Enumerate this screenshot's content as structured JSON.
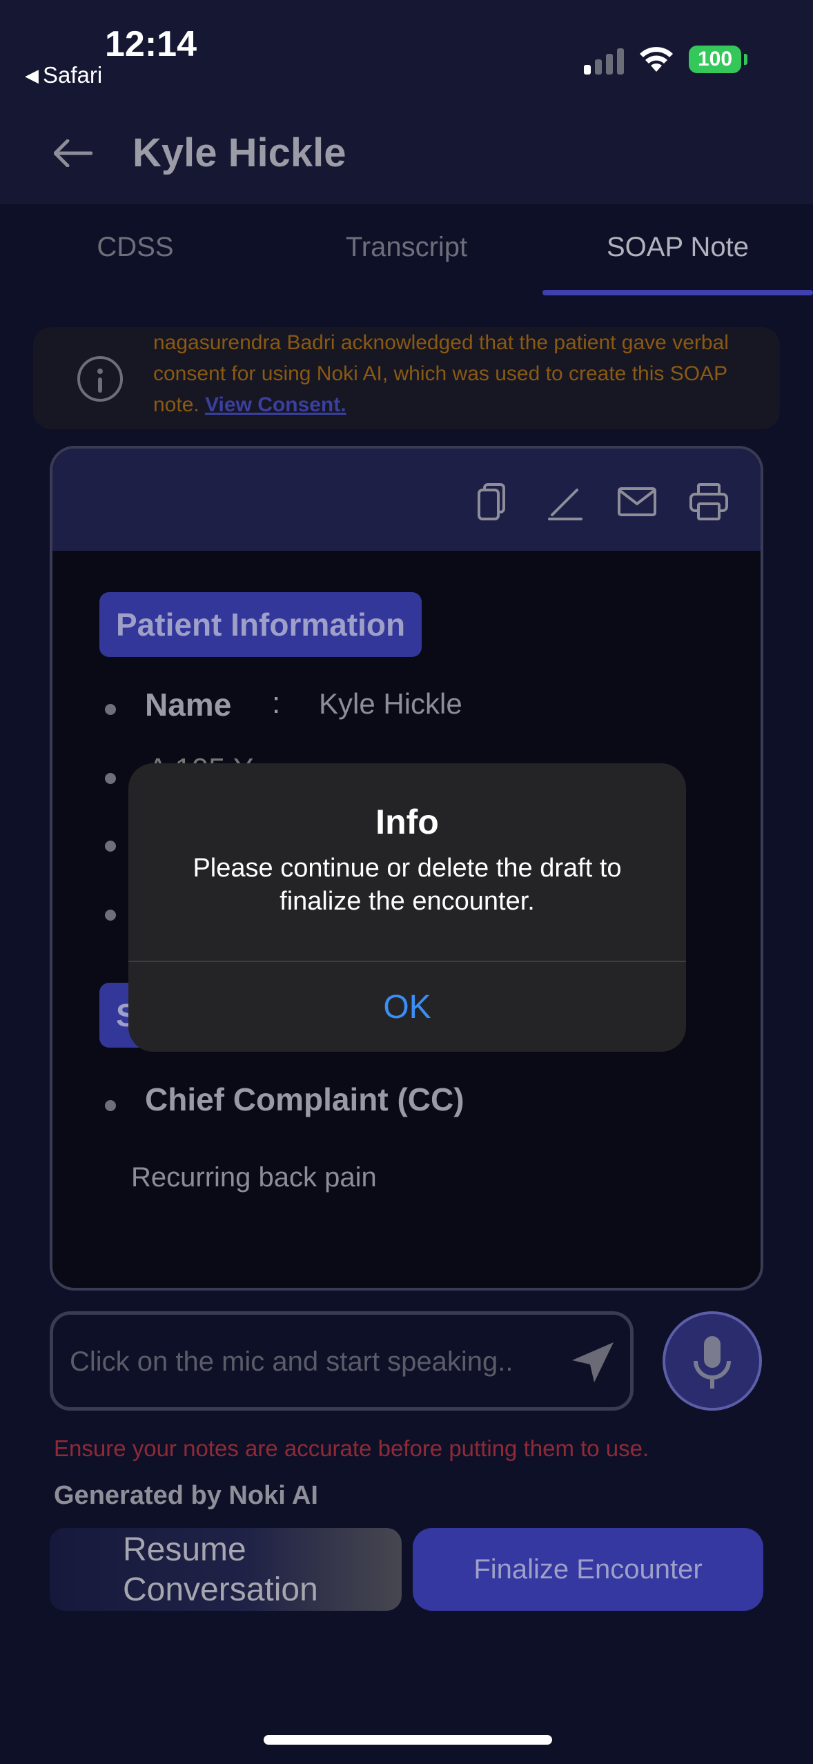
{
  "status_bar": {
    "time": "12:14",
    "back_app": "Safari",
    "battery": "100"
  },
  "header": {
    "title": "Kyle Hickle"
  },
  "tabs": [
    {
      "label": "CDSS",
      "active": false
    },
    {
      "label": "Transcript",
      "active": false
    },
    {
      "label": "SOAP Note",
      "active": true
    }
  ],
  "consent": {
    "text": "nagasurendra Badri acknowledged that the patient gave verbal consent for using Noki AI, which was used to create this SOAP note.",
    "link": "View Consent."
  },
  "soap": {
    "toolbar_icons": [
      "copy-icon",
      "edit-icon",
      "mail-icon",
      "print-icon"
    ],
    "patient_info_title": "Patient Information",
    "name_label": "Name",
    "name_value": "Kyle Hickle",
    "partial_row": "A          105 Y",
    "subjective_badge_initial": "S",
    "chief_complaint_label": "Chief Complaint (CC)",
    "chief_complaint_value": "Recurring back pain"
  },
  "input": {
    "placeholder": "Click on the mic and start speaking.."
  },
  "footer": {
    "warning": "Ensure your notes are accurate before putting them to use.",
    "generated_by": "Generated by Noki AI",
    "resume_line1": "Resume",
    "resume_line2": "Conversation",
    "finalize_label": "Finalize Encounter"
  },
  "alert": {
    "title": "Info",
    "message": "Please continue or delete the draft to finalize the encounter.",
    "ok_label": "OK"
  },
  "colors": {
    "background": "#0e1028",
    "accent": "#3438a0",
    "warning": "#8f2a36",
    "consent_text": "#8a5a12",
    "alert_button": "#3b8ef6"
  }
}
